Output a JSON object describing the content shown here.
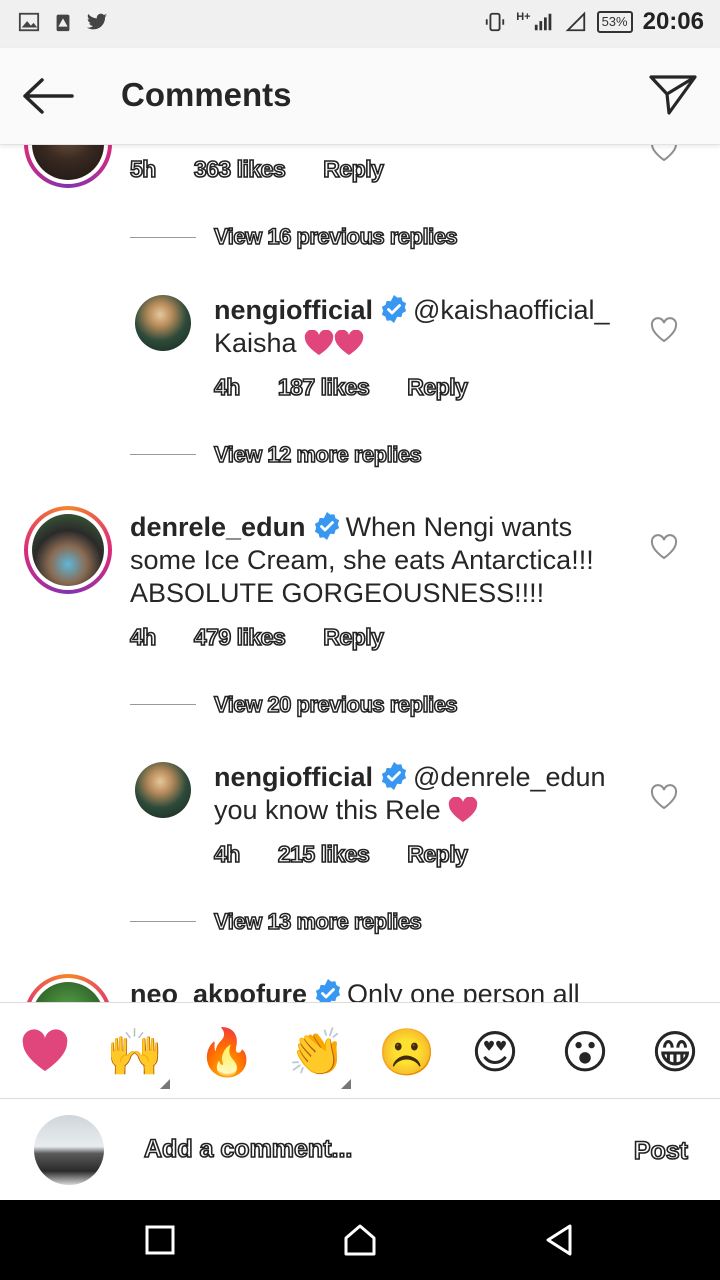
{
  "status": {
    "battery": "53%",
    "time": "20:06",
    "network": "H+"
  },
  "header": {
    "title": "Comments"
  },
  "comments": [
    {
      "time": "5h",
      "likes": "363 likes",
      "reply": "Reply",
      "view": "View 16 previous replies"
    },
    {
      "user": "nengiofficial",
      "text1": "@kaishaofficial_",
      "text2": "Kaisha",
      "time": "4h",
      "likes": "187 likes",
      "reply": "Reply",
      "view": "View 12 more replies"
    },
    {
      "user": "denrele_edun",
      "text1": "When Nengi wants",
      "text2": "some Ice Cream, she eats Antarctica!!!",
      "text3": "ABSOLUTE GORGEOUSNESS!!!!",
      "time": "4h",
      "likes": "479 likes",
      "reply": "Reply",
      "view": "View 20 previous replies"
    },
    {
      "user": "nengiofficial",
      "text1": "@denrele_edun",
      "text2": "you know this Rele",
      "time": "4h",
      "likes": "215 likes",
      "reply": "Reply",
      "view": "View 13 more replies"
    },
    {
      "user": "neo_akpofure",
      "text1": "Only one person all"
    }
  ],
  "emojis": [
    "heart-emoji",
    "raised-hands-emoji",
    "fire-emoji",
    "clapping-hands-emoji",
    "sad-face-emoji",
    "heart-eyes-emoji",
    "surprised-face-emoji",
    "laughing-face-emoji"
  ],
  "composer": {
    "placeholder": "Add a comment...",
    "post": "Post"
  },
  "colors": {
    "heart": "#e0457b",
    "verified": "#3897f0",
    "nav": "#000000"
  }
}
